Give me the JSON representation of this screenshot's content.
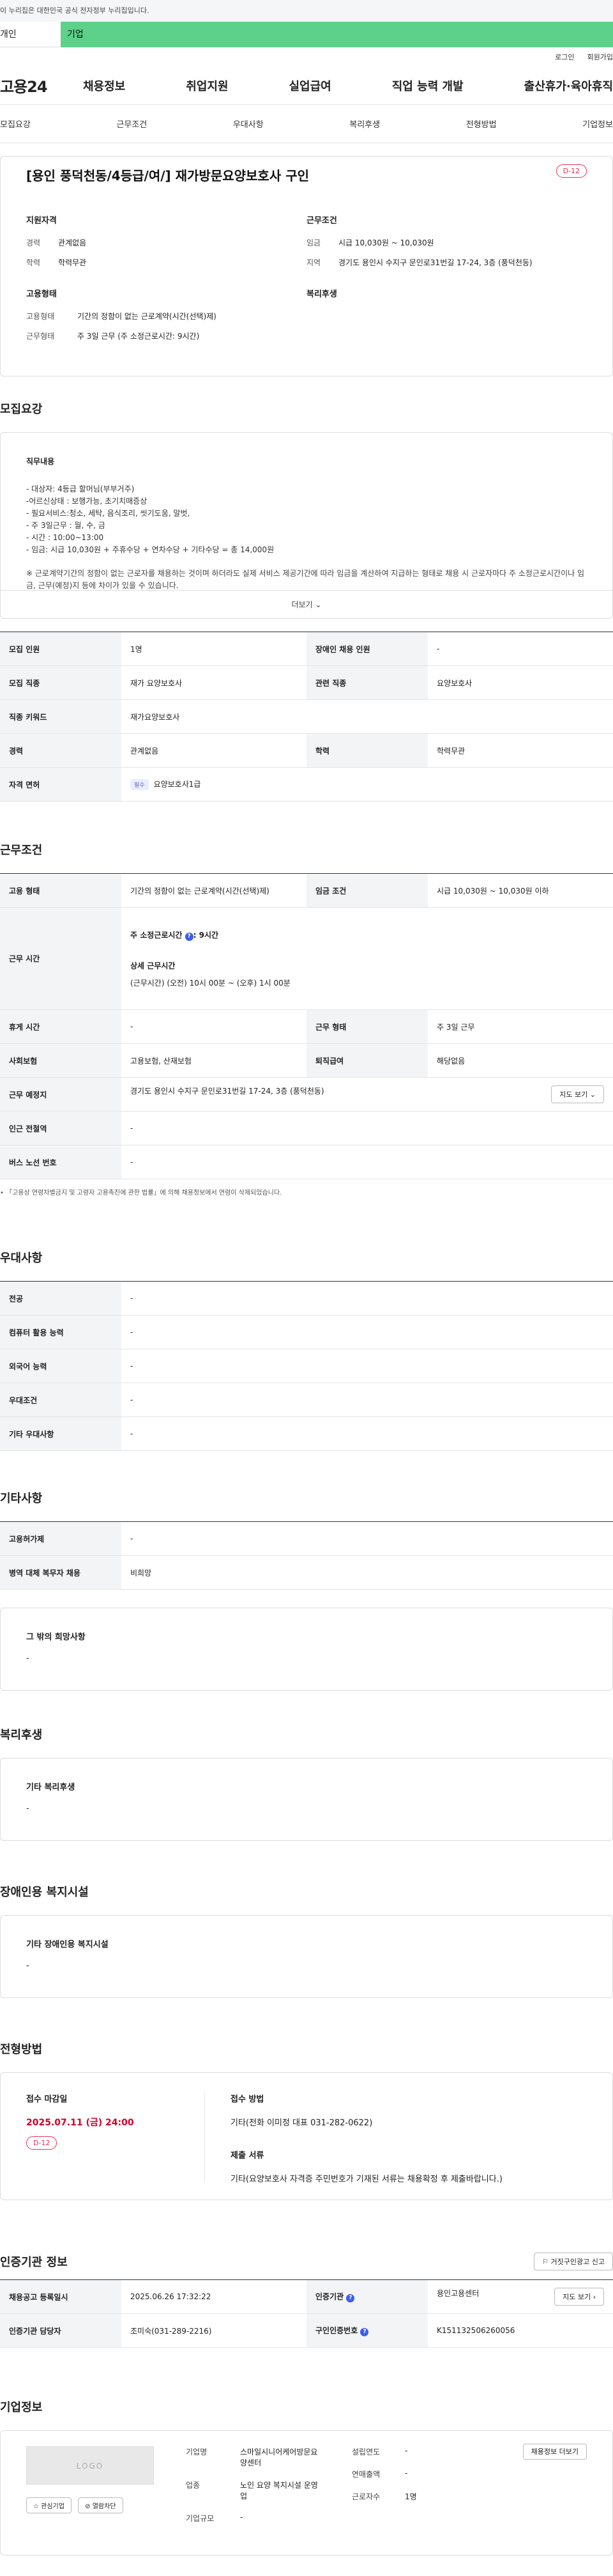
{
  "gov_banner": "이 누리집은 대한민국 공식 전자정부 누리집입니다.",
  "tabs": {
    "individual": "개인",
    "company": "기업"
  },
  "util": {
    "login": "로그인",
    "join": "회원가입"
  },
  "gnb": {
    "logo": "고용24",
    "menu": [
      "채용정보",
      "취업지원",
      "실업급여",
      "직업 능력 개발",
      "출산휴가·육아휴직"
    ]
  },
  "subnav": [
    "모집요강",
    "근무조건",
    "우대사항",
    "복리후생",
    "전형방법",
    "기업정보"
  ],
  "job": {
    "title": "[용인 풍덕천동/4등급/여/] 재가방문요양보호사 구인",
    "dday": "D-12",
    "qual_title": "지원자격",
    "cond_title": "근무조건",
    "emp_title": "고용형태",
    "welfare_title": "복리후생",
    "qual": [
      {
        "k": "경력",
        "v": "관계없음"
      },
      {
        "k": "학력",
        "v": "학력무관"
      }
    ],
    "cond": [
      {
        "k": "임금",
        "v": "시급 10,030원 ~ 10,030원"
      },
      {
        "k": "지역",
        "v": "경기도 용인시 수지구 문인로31번길 17-24, 3층 (풍덕천동)"
      }
    ],
    "emp": [
      {
        "k": "고용형태",
        "v": "기간의 정함이 없는 근로계약(시간(선택)제)"
      },
      {
        "k": "근무형태",
        "v": "주 3일 근무 (주 소정근로시간: 9시간)"
      }
    ]
  },
  "recruit": {
    "title": "모집요강",
    "duty_title": "직무내용",
    "lines": [
      "- 대상자: 4등급 할머님(부부거주)",
      "-어르신상태 : 보행가능, 초기치매증상",
      "- 필요서비스:청소, 세탁, 음식조리, 씻기도움, 말벗,",
      "- 주 3일근무 : 월, 수, 금",
      "- 시간 : 10:00~13:00",
      "- 임금: 시급 10,030원 + 주휴수당 + 연차수당 + 기타수당 = 총 14,000원"
    ],
    "notice": "※ 근로계약기간의 정함이 없는 근로자를 채용하는 것이며 하더라도 실제 서비스 제공기간에 따라 임금을 계산하여 지급하는 형태로 채용 시 근로자마다 주 소정근로시간이나 임금, 근무(예정)지 등에 차이가 있을 수 있습니다.",
    "more": "더보기",
    "rows": [
      {
        "k1": "모집 인원",
        "v1": "1명",
        "k2": "장애인 채용 인원",
        "v2": "-"
      },
      {
        "k1": "모집 직종",
        "v1": "재가 요양보호사",
        "k2": "관련 직종",
        "v2": "요양보호사"
      },
      {
        "k1": "직종 키워드",
        "v1": "재가요양보호사",
        "k2": "",
        "v2": ""
      },
      {
        "k1": "경력",
        "v1": "관계없음",
        "k2": "학력",
        "v2": "학력무관"
      }
    ],
    "license_k": "자격 면허",
    "license_badge": "필수",
    "license_v": "요양보호사1급"
  },
  "work": {
    "title": "근무조건",
    "type_k": "고용 형태",
    "type_v": "기간의 정함이 없는 근로계약(시간(선택)제)",
    "wage_k": "임금 조건",
    "wage_v": "시급 10,030원 ~ 10,030원 이하",
    "hours_k": "근무 시간",
    "hours_week": "주 소정근로시간",
    "hours_week_v": ": 9시간",
    "hours_detail_t": "상세 근무시간",
    "hours_detail_v": "(근무시간) (오전) 10시 00분 ~ (오후) 1시 00분",
    "break_k": "휴게 시간",
    "break_v": "-",
    "form_k": "근무 형태",
    "form_v": "주 3일 근무",
    "ins_k": "사회보험",
    "ins_v": "고용보험, 산재보험",
    "ret_k": "퇴직급여",
    "ret_v": "해당없음",
    "place_k": "근무 예정지",
    "place_v": "경기도 용인시 수지구 문인로31번길 17-24, 3층 (풍덕천동)",
    "map_btn": "지도 보기",
    "subway_k": "인근 전철역",
    "subway_v": "-",
    "bus_k": "버스 노선 번호",
    "bus_v": "-",
    "footnote": "• 「고용상 연령차별금지 및 고령자 고용촉진에 관한 법률」에 의해 채용정보에서 연령이 삭제되었습니다."
  },
  "pref": {
    "title": "우대사항",
    "rows": [
      {
        "k": "전공",
        "v": "-"
      },
      {
        "k": "컴퓨터 활용 능력",
        "v": "-"
      },
      {
        "k": "외국어 능력",
        "v": "-"
      },
      {
        "k": "우대조건",
        "v": "-"
      },
      {
        "k": "기타 우대사항",
        "v": "-"
      }
    ]
  },
  "etc": {
    "title": "기타사항",
    "rows": [
      {
        "k": "고용허가제",
        "v": "-"
      },
      {
        "k": "병역 대체 복무자 채용",
        "v": "비희망"
      }
    ],
    "other_t": "그 밖의 희망사항",
    "other_v": "-"
  },
  "welfare": {
    "title": "복리후생",
    "box_t": "기타 복리후생",
    "box_v": "-"
  },
  "disab": {
    "title": "장애인용 복지시설",
    "box_t": "기타 장애인용 복지시설",
    "box_v": "-"
  },
  "process": {
    "title": "전형방법",
    "deadline_t": "접수 마감일",
    "deadline_v": "2025.07.11 (금) 24:00",
    "dday": "D-12",
    "method_t": "접수 방법",
    "method_v": "기타(전화 이미정 대표 031-282-0622)",
    "docs_t": "제출 서류",
    "docs_v": "기타(요양보호사 자격증 주민번호가 기재된 서류는 채용확정 후 제출바랍니다.)"
  },
  "cert": {
    "title": "인증기관 정보",
    "report_btn": "거짓구인광고 신고",
    "reg_k": "채용공고 등록일시",
    "reg_v": "2025.06.26 17:32:22",
    "agency_k": "인증기관",
    "agency_v": "용인고용센터",
    "map_btn": "지도 보기",
    "mgr_k": "인증기관 담당자",
    "mgr_v": "조미숙(031-289-2216)",
    "num_k": "구인인증번호",
    "num_v": "K151132506260056"
  },
  "company": {
    "title": "기업정보",
    "logo": "LOGO",
    "fav_btn": "관심기업",
    "block_btn": "열람차단",
    "name_k": "기업명",
    "name_v": "스마일시니어케어방문요양센터",
    "industry_k": "업종",
    "industry_v": "노인 요양 복지시설 운영업",
    "size_k": "기업규모",
    "size_v": "-",
    "founded_k": "설립연도",
    "founded_v": "-",
    "revenue_k": "연매출액",
    "revenue_v": "-",
    "staff_k": "근로자수",
    "staff_v": "1명",
    "more_btn": "채용정보 더보기"
  }
}
